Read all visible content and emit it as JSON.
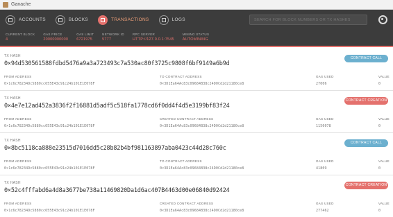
{
  "window": {
    "title": "Ganache"
  },
  "nav": {
    "items": [
      {
        "label": "ACCOUNTS",
        "icon": "accounts-icon",
        "active": false
      },
      {
        "label": "BLOCKS",
        "icon": "blocks-icon",
        "active": false
      },
      {
        "label": "TRANSACTIONS",
        "icon": "transactions-icon",
        "active": true
      },
      {
        "label": "LOGS",
        "icon": "logs-icon",
        "active": false
      }
    ],
    "search_placeholder": "SEARCH FOR BLOCK NUMBERS OR TX HASHES"
  },
  "stats": {
    "current_block": {
      "label": "CURRENT BLOCK",
      "value": "4"
    },
    "gas_price": {
      "label": "GAS PRICE",
      "value": "20000000000"
    },
    "gas_limit": {
      "label": "GAS LIMIT",
      "value": "6721975"
    },
    "network_id": {
      "label": "NETWORK ID",
      "value": "5777"
    },
    "rpc_server": {
      "label": "RPC SERVER",
      "value": "HTTP://127.0.0.1:7545"
    },
    "mining_status": {
      "label": "MINING STATUS",
      "value": "AUTOMINING"
    }
  },
  "colors": {
    "accent": "#e4716d",
    "call": "#6cb0cf",
    "nav_bg": "#3c3c3c"
  },
  "transactions": [
    {
      "hash_label": "TX HASH",
      "hash": "0×94d530561588fdbd5476a9a3a723493c7a530ac80f3725c9808f6bf9149a6b9d",
      "badge": "CONTRACT CALL",
      "from_label": "FROM ADDRESS",
      "from": "0×1c6c78234Dc5880cc655E43c91c24b101E1E078F",
      "to_label": "TO CONTRACT ADDRESS",
      "to": "0×3D1Ea64Ac83c09684B38c24D0Cd2d21180ce8",
      "gas_label": "GAS USED",
      "gas": "27006",
      "value_label": "VALUE",
      "value": "0"
    },
    {
      "hash_label": "TX HASH",
      "hash": "0×4e7e12ad452a3836f2f16881d5adf5c518fa1778cd6f0dd4f4d5e3199bf83f24",
      "badge": "CONTRACT CREATION",
      "from_label": "FROM ADDRESS",
      "from": "0×1c6c78234Dc5880cc655E43c91c24b101E1E078F",
      "to_label": "CREATED CONTRACT ADDRESS",
      "to": "0×3D1Ea64Ac83c09684B38c24D0Cd2d21180ce8",
      "gas_label": "GAS USED",
      "gas": "1150078",
      "value_label": "VALUE",
      "value": "0"
    },
    {
      "hash_label": "TX HASH",
      "hash": "0×8bc5118ca888e23515d7016dd5c28b82b4bf981163897aba0423c44d28c760c",
      "badge": "CONTRACT CALL",
      "from_label": "FROM ADDRESS",
      "from": "0×1c6c78234Dc5880cc655E43c91c24b101E1E078F",
      "to_label": "TO CONTRACT ADDRESS",
      "to": "0×3D1Ea64Ac83c09684B38c24D0Cd2d21180ce8",
      "gas_label": "GAS USED",
      "gas": "41809",
      "value_label": "VALUE",
      "value": "0"
    },
    {
      "hash_label": "TX HASH",
      "hash": "0×52c4fffabd6a4d8a3677be738a11469820Da1d6ac407B4463d00e06840d92424",
      "badge": "CONTRACT CREATION",
      "from_label": "FROM ADDRESS",
      "from": "0×1c6c78234Dc5880cc655E43c91c24b101E1E078F",
      "to_label": "CREATED CONTRACT ADDRESS",
      "to": "0×3D1Ea64Ac83c09684B38c24D0Cd2d21180ce8",
      "gas_label": "GAS USED",
      "gas": "277462",
      "value_label": "VALUE",
      "value": "0"
    }
  ]
}
